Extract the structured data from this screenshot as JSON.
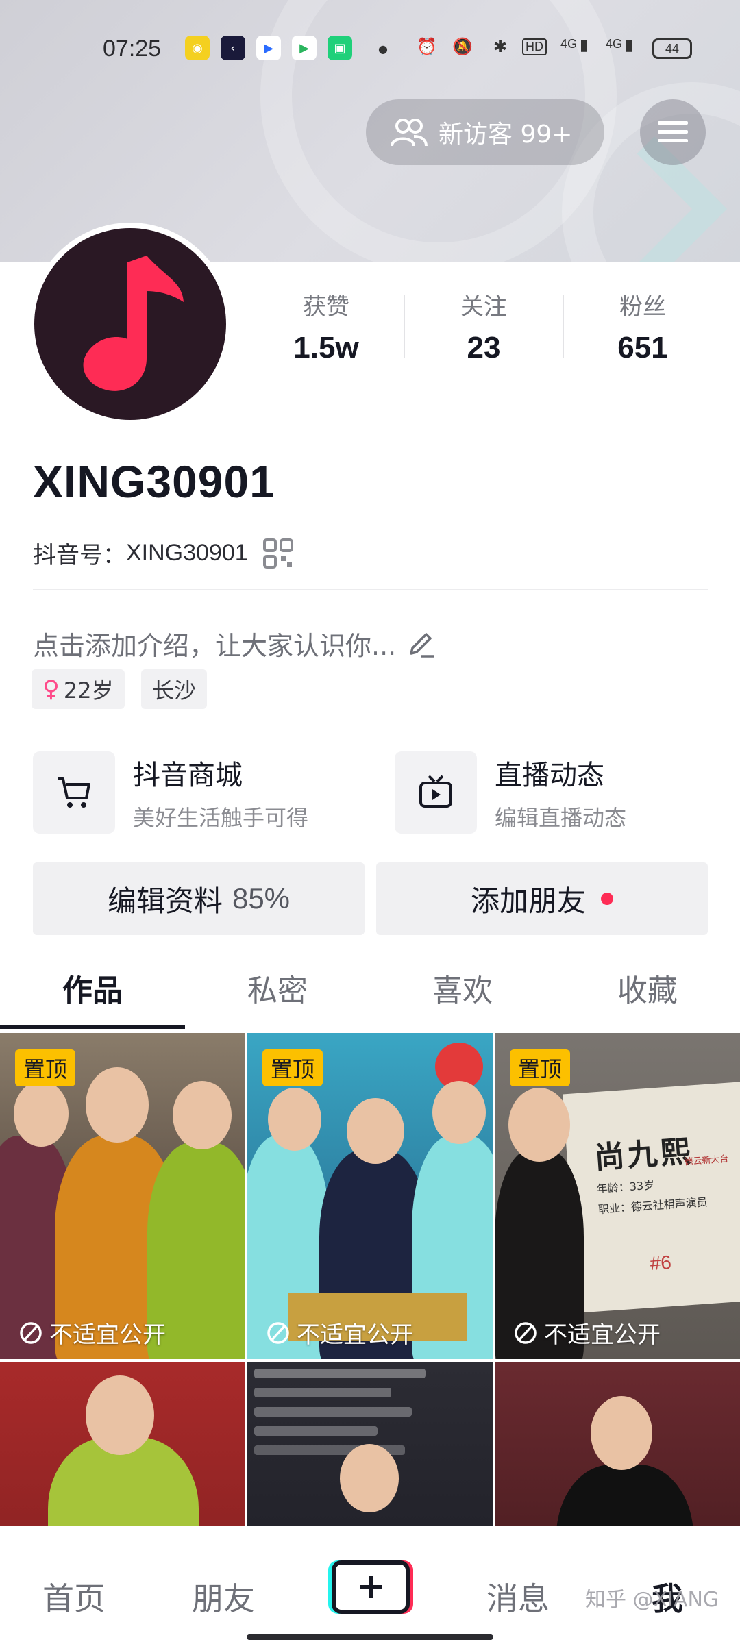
{
  "status_bar": {
    "time": "07:25",
    "network_1": "4G",
    "network_2": "4G",
    "hd_label": "HD",
    "battery": "44"
  },
  "header": {
    "visitors_label": "新访客 99+"
  },
  "profile": {
    "username": "XING30901",
    "douyin_id_label": "抖音号：",
    "douyin_id": "XING30901",
    "bio_placeholder": "点击添加介绍，让大家认识你...",
    "tags": {
      "age": "22岁",
      "city": "长沙"
    }
  },
  "stats": [
    {
      "label": "获赞",
      "value": "1.5w"
    },
    {
      "label": "关注",
      "value": "23"
    },
    {
      "label": "粉丝",
      "value": "651"
    }
  ],
  "features": {
    "mall": {
      "title": "抖音商城",
      "subtitle": "美好生活触手可得",
      "icon": "cart-icon"
    },
    "live": {
      "title": "直播动态",
      "subtitle": "编辑直播动态",
      "icon": "tv-icon"
    }
  },
  "actions": {
    "edit_label": "编辑资料",
    "edit_percent": "85%",
    "add_friends_label": "添加朋友"
  },
  "tabs": [
    "作品",
    "私密",
    "喜欢",
    "收藏"
  ],
  "grid": {
    "pinned_label": "置顶",
    "unsuitable_label": "不适宜公开",
    "card_name": "尚九熙",
    "card_age": "年龄：33岁",
    "card_job": "职业：德云社相声演员",
    "card_num": "#6",
    "card_tag": "德云新大台"
  },
  "nav": {
    "home": "首页",
    "friends": "朋友",
    "messages": "消息",
    "me": "我",
    "watermark": "知乎 @XIANG"
  },
  "colors": {
    "accent_red": "#fe2c55",
    "accent_cyan": "#25f4ee",
    "pin_yellow": "#fcc000"
  }
}
